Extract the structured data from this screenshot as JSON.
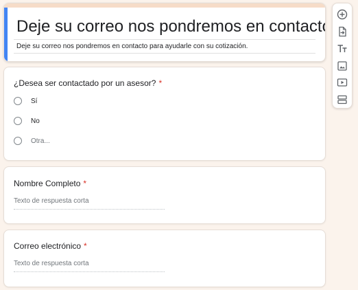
{
  "form": {
    "title": "Deje su correo nos pondremos en contacto",
    "description": "Deje su correo nos pondremos en contacto para ayudarle con su cotización."
  },
  "questions": [
    {
      "title": "¿Desea ser contactado por un asesor?",
      "required_mark": "*",
      "type": "multiple-choice",
      "options": [
        "Sí",
        "No",
        "Otra..."
      ]
    },
    {
      "title": "Nombre Completo",
      "required_mark": "*",
      "type": "short-answer",
      "placeholder": "Texto de respuesta corta"
    },
    {
      "title": "Correo electrónico",
      "required_mark": "*",
      "type": "short-answer",
      "placeholder": "Texto de respuesta corta"
    }
  ],
  "toolbar": {
    "tools": [
      {
        "icon": "add-question-icon"
      },
      {
        "icon": "import-questions-icon"
      },
      {
        "icon": "add-title-icon"
      },
      {
        "icon": "add-image-icon"
      },
      {
        "icon": "add-video-icon"
      },
      {
        "icon": "add-section-icon"
      }
    ]
  },
  "colors": {
    "accent": "#4285f4",
    "header_stripe": "#f6dcc8",
    "background": "#fbf3ec",
    "required": "#d93025"
  }
}
